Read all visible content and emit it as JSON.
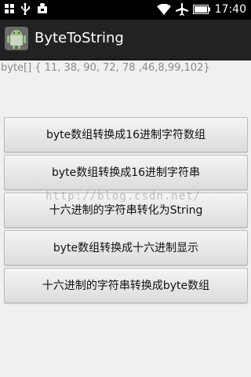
{
  "status_bar": {
    "time": "17:40",
    "left_icons": [
      "grid-icon",
      "usb-icon",
      "android-debug-icon"
    ],
    "right_icons": [
      "wifi-icon",
      "airplane-icon",
      "battery-icon"
    ]
  },
  "action_bar": {
    "title": "ByteToString",
    "icon": "android-robot-icon"
  },
  "content": {
    "byte_text": "byte[] { 11, 38, 90, 72, 78 ,46,8,99,102}",
    "buttons": [
      {
        "label": "byte数组转换成16进制字符数组"
      },
      {
        "label": "byte数组转换成16进制字符串"
      },
      {
        "label": "十六进制的字符串转化为String"
      },
      {
        "label": "byte数组转换成十六进制显示"
      },
      {
        "label": "十六进制的字符串转换成byte数组"
      }
    ],
    "watermark": "http://blog.csdn.net/"
  }
}
